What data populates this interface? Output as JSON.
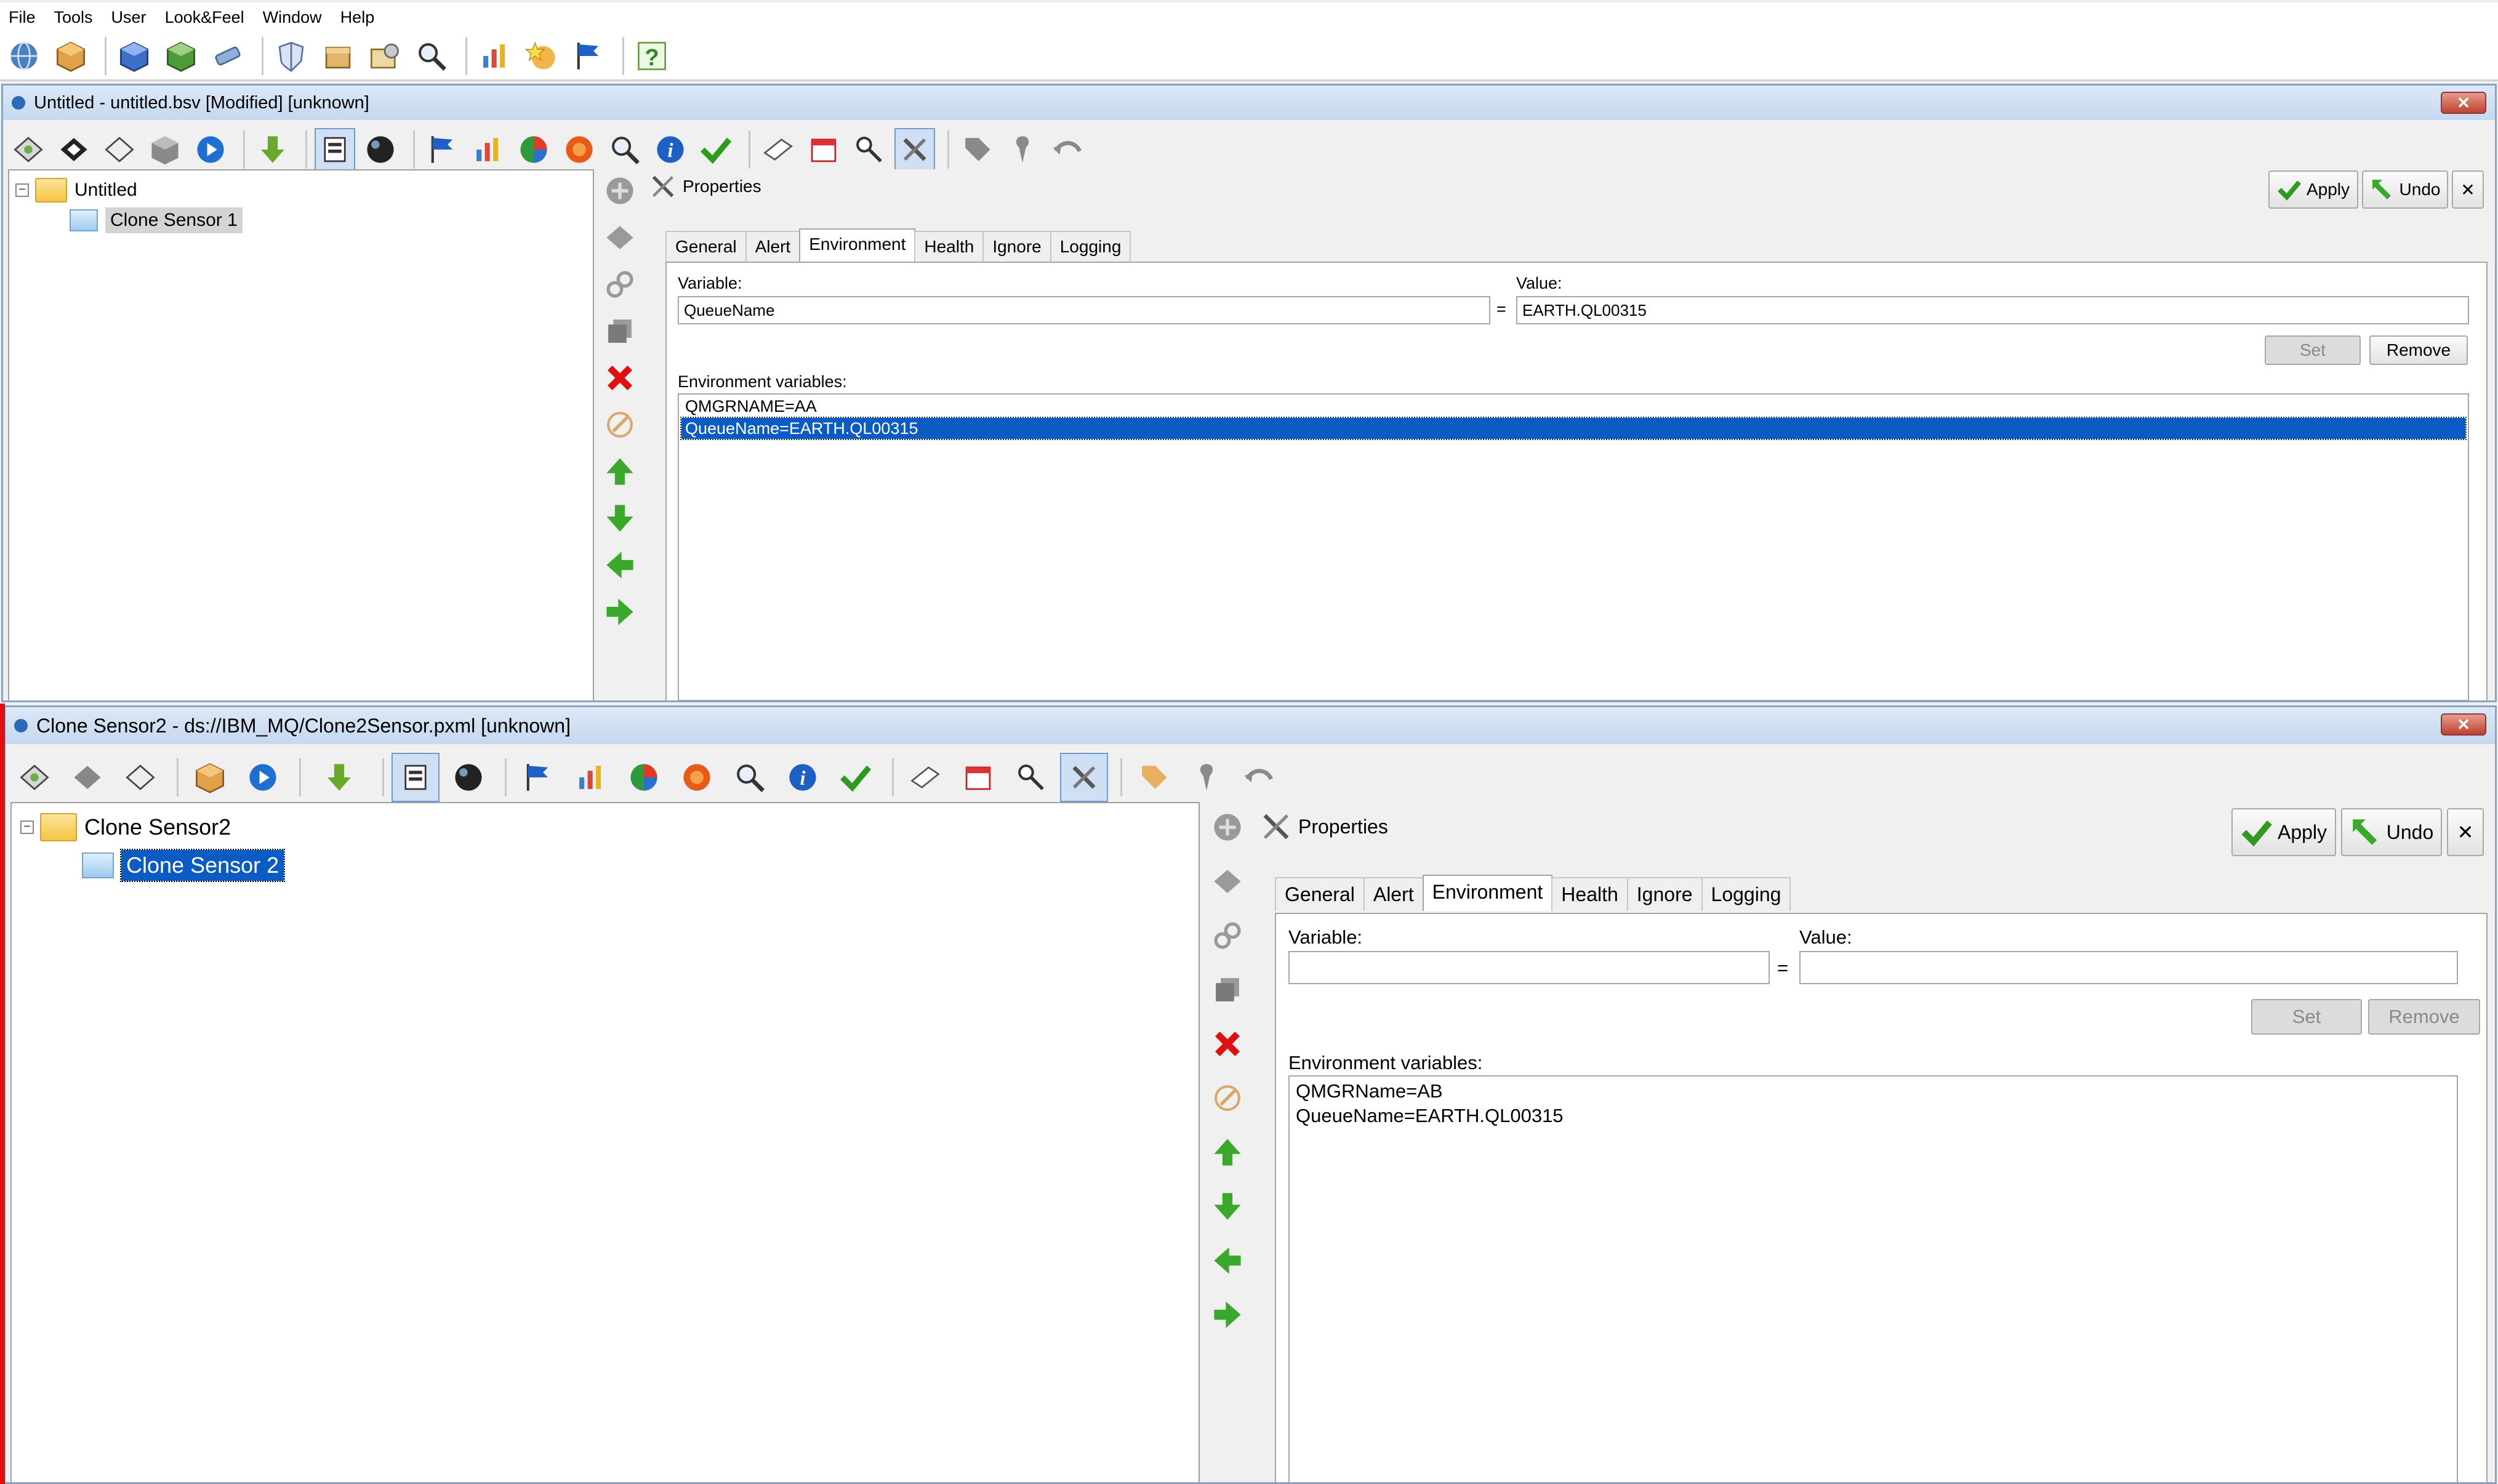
{
  "menu": [
    "File",
    "Tools",
    "User",
    "Look&Feel",
    "Window",
    "Help"
  ],
  "main_toolbar_icons": [
    "globe-icon",
    "cube-box-icon",
    "blue-cube-icon",
    "green-cube-icon",
    "satellite-icon",
    "shield-icon",
    "box-icon",
    "gear-box-icon",
    "magnifier-icon",
    "chart-tools-icon",
    "star-globe-icon",
    "flag-icon",
    "help-icon"
  ],
  "frame1": {
    "title": "Untitled - untitled.bsv [Modified] [unknown]",
    "tree": {
      "root": "Untitled",
      "child": "Clone Sensor 1"
    },
    "properties": {
      "header": "Properties",
      "apply": "Apply",
      "undo": "Undo",
      "close": "✕",
      "tabs": [
        "General",
        "Alert",
        "Environment",
        "Health",
        "Ignore",
        "Logging"
      ],
      "active_tab": "Environment",
      "variable_label": "Variable:",
      "variable_value": "QueueName",
      "equals": "=",
      "value_label": "Value:",
      "value_value": "EARTH.QL00315",
      "set": "Set",
      "remove": "Remove",
      "env_label": "Environment variables:",
      "env_items": [
        "QMGRNAME=AA",
        "QueueName=EARTH.QL00315"
      ],
      "selected_index": 1
    }
  },
  "frame2": {
    "title": "Clone Sensor2 - ds://IBM_MQ/Clone2Sensor.pxml [unknown]",
    "tree": {
      "root": "Clone Sensor2",
      "child": "Clone Sensor 2"
    },
    "properties": {
      "header": "Properties",
      "apply": "Apply",
      "undo": "Undo",
      "close": "✕",
      "tabs": [
        "General",
        "Alert",
        "Environment",
        "Health",
        "Ignore",
        "Logging"
      ],
      "active_tab": "Environment",
      "variable_label": "Variable:",
      "variable_value": "",
      "equals": "=",
      "value_label": "Value:",
      "value_value": "",
      "set": "Set",
      "remove": "Remove",
      "env_label": "Environment variables:",
      "env_items": [
        "QMGRName=AB",
        "QueueName=EARTH.QL00315"
      ]
    }
  },
  "colors": {
    "selection": "#0a5bc4",
    "frame_border": "#8aa3c2",
    "accent_red": "#e01010"
  }
}
